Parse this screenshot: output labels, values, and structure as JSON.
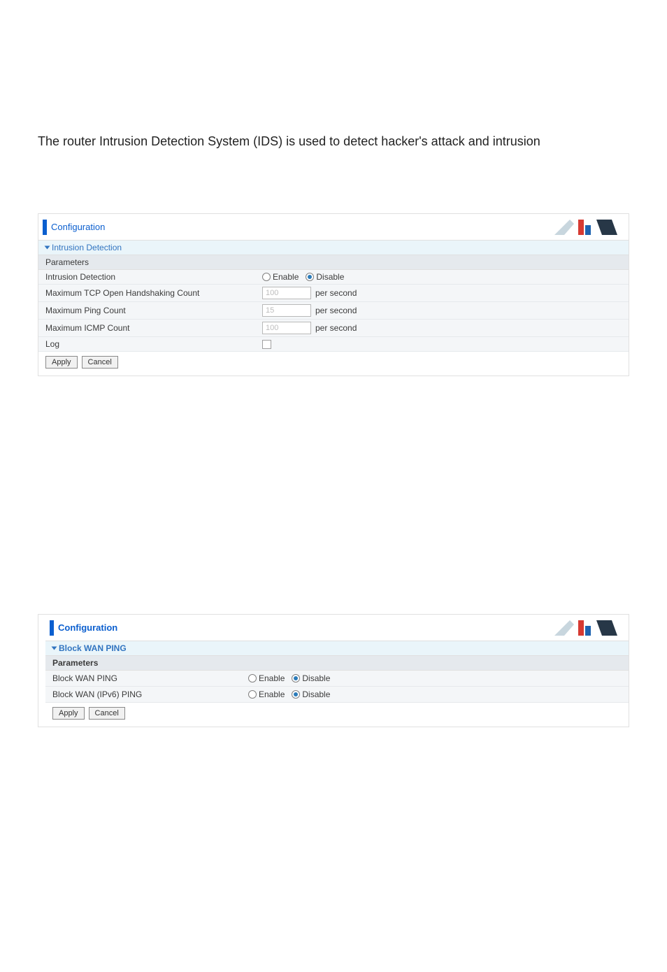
{
  "lead_text": "The router Intrusion Detection System (IDS) is used to detect hacker's attack and intrusion",
  "panel1": {
    "title": "Configuration",
    "section_title": "Intrusion Detection",
    "subhead": "Parameters",
    "rows": {
      "intrusion_detection": {
        "label": "Intrusion Detection",
        "enable": "Enable",
        "disable": "Disable",
        "selected": "disable"
      },
      "tcp": {
        "label": "Maximum TCP Open Handshaking Count",
        "value": "100",
        "suffix": "per second"
      },
      "ping": {
        "label": "Maximum Ping Count",
        "value": "15",
        "suffix": "per second"
      },
      "icmp": {
        "label": "Maximum ICMP Count",
        "value": "100",
        "suffix": "per second"
      },
      "log": {
        "label": "Log",
        "checked": false
      }
    },
    "buttons": {
      "apply": "Apply",
      "cancel": "Cancel"
    }
  },
  "panel2": {
    "title": "Configuration",
    "section_title": "Block WAN PING",
    "subhead": "Parameters",
    "rows": {
      "wan": {
        "label": "Block WAN PING",
        "enable": "Enable",
        "disable": "Disable",
        "selected": "disable"
      },
      "wan6": {
        "label": "Block WAN (IPv6) PING",
        "enable": "Enable",
        "disable": "Disable",
        "selected": "disable"
      }
    },
    "buttons": {
      "apply": "Apply",
      "cancel": "Cancel"
    }
  }
}
